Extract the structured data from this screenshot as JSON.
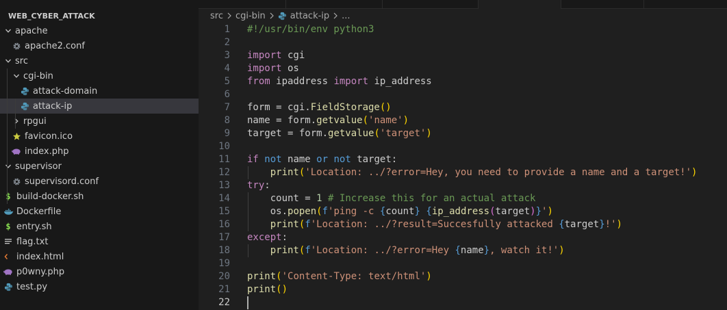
{
  "explorer": {
    "root_label": "WEB_CYBER_ATTACK",
    "items": [
      {
        "label": "apache",
        "kind": "folder",
        "icon": "chevron-down-icon",
        "file_icon": "",
        "depth": 0
      },
      {
        "label": "apache2.conf",
        "kind": "file",
        "icon": "",
        "file_icon": "gear-icon",
        "depth": 1
      },
      {
        "label": "src",
        "kind": "folder",
        "icon": "chevron-down-icon",
        "file_icon": "",
        "depth": 0
      },
      {
        "label": "cgi-bin",
        "kind": "folder",
        "icon": "chevron-down-icon",
        "file_icon": "",
        "depth": 1
      },
      {
        "label": "attack-domain",
        "kind": "file",
        "icon": "",
        "file_icon": "python-icon",
        "depth": 2
      },
      {
        "label": "attack-ip",
        "kind": "file",
        "icon": "",
        "file_icon": "python-icon",
        "depth": 2,
        "selected": true
      },
      {
        "label": "rpgui",
        "kind": "folder",
        "icon": "chevron-right-icon",
        "file_icon": "",
        "depth": 1
      },
      {
        "label": "favicon.ico",
        "kind": "file",
        "icon": "",
        "file_icon": "star-icon",
        "depth": 1
      },
      {
        "label": "index.php",
        "kind": "file",
        "icon": "",
        "file_icon": "php-icon",
        "depth": 1
      },
      {
        "label": "supervisor",
        "kind": "folder",
        "icon": "chevron-down-icon",
        "file_icon": "",
        "depth": 0
      },
      {
        "label": "supervisord.conf",
        "kind": "file",
        "icon": "",
        "file_icon": "gear-icon",
        "depth": 1
      },
      {
        "label": "build-docker.sh",
        "kind": "file",
        "icon": "",
        "file_icon": "shell-icon",
        "depth": 0
      },
      {
        "label": "Dockerfile",
        "kind": "file",
        "icon": "",
        "file_icon": "docker-icon",
        "depth": 0
      },
      {
        "label": "entry.sh",
        "kind": "file",
        "icon": "",
        "file_icon": "shell-icon",
        "depth": 0
      },
      {
        "label": "flag.txt",
        "kind": "file",
        "icon": "",
        "file_icon": "text-lines-icon",
        "depth": 0
      },
      {
        "label": "index.html",
        "kind": "file",
        "icon": "",
        "file_icon": "html-icon",
        "depth": 0
      },
      {
        "label": "p0wny.php",
        "kind": "file",
        "icon": "",
        "file_icon": "php-icon",
        "depth": 0
      },
      {
        "label": "test.py",
        "kind": "file",
        "icon": "",
        "file_icon": "python-icon",
        "depth": 0
      }
    ]
  },
  "breadcrumbs": {
    "parts": [
      "src",
      "cgi-bin",
      "attack-ip",
      "..."
    ],
    "file_icon": "python-icon"
  },
  "editor": {
    "current_line": 22,
    "lines": [
      {
        "n": "1",
        "tokens": [
          {
            "t": "#!/usr/bin/env python3",
            "c": "cm"
          }
        ]
      },
      {
        "n": "2",
        "tokens": []
      },
      {
        "n": "3",
        "tokens": [
          {
            "t": "import",
            "c": "kw"
          },
          {
            "t": " cgi",
            "c": "ident"
          }
        ]
      },
      {
        "n": "4",
        "tokens": [
          {
            "t": "import",
            "c": "kw"
          },
          {
            "t": " os",
            "c": "ident"
          }
        ]
      },
      {
        "n": "5",
        "tokens": [
          {
            "t": "from",
            "c": "kw"
          },
          {
            "t": " ipaddress ",
            "c": "ident"
          },
          {
            "t": "import",
            "c": "kw"
          },
          {
            "t": " ip_address",
            "c": "ident"
          }
        ]
      },
      {
        "n": "6",
        "tokens": []
      },
      {
        "n": "7",
        "tokens": [
          {
            "t": "form = cgi.",
            "c": "ident"
          },
          {
            "t": "FieldStorage",
            "c": "fn"
          },
          {
            "t": "()",
            "c": "br1"
          }
        ]
      },
      {
        "n": "8",
        "tokens": [
          {
            "t": "name = form.",
            "c": "ident"
          },
          {
            "t": "getvalue",
            "c": "fn"
          },
          {
            "t": "(",
            "c": "br1"
          },
          {
            "t": "'name'",
            "c": "str"
          },
          {
            "t": ")",
            "c": "br1"
          }
        ]
      },
      {
        "n": "9",
        "tokens": [
          {
            "t": "target = form.",
            "c": "ident"
          },
          {
            "t": "getvalue",
            "c": "fn"
          },
          {
            "t": "(",
            "c": "br1"
          },
          {
            "t": "'target'",
            "c": "str"
          },
          {
            "t": ")",
            "c": "br1"
          }
        ]
      },
      {
        "n": "10",
        "tokens": []
      },
      {
        "n": "11",
        "tokens": [
          {
            "t": "if",
            "c": "kw"
          },
          {
            "t": " ",
            "c": "ident"
          },
          {
            "t": "not",
            "c": "kb"
          },
          {
            "t": " name ",
            "c": "ident"
          },
          {
            "t": "or",
            "c": "kb"
          },
          {
            "t": " ",
            "c": "ident"
          },
          {
            "t": "not",
            "c": "kb"
          },
          {
            "t": " target:",
            "c": "ident"
          }
        ]
      },
      {
        "n": "12",
        "tokens": [
          {
            "t": "    ",
            "c": "ident"
          },
          {
            "t": "print",
            "c": "fn"
          },
          {
            "t": "(",
            "c": "br1"
          },
          {
            "t": "'Location: ../?error=Hey, you need to provide a name and a target!'",
            "c": "str"
          },
          {
            "t": ")",
            "c": "br1"
          }
        ]
      },
      {
        "n": "13",
        "tokens": [
          {
            "t": "try",
            "c": "kw"
          },
          {
            "t": ":",
            "c": "ident"
          }
        ]
      },
      {
        "n": "14",
        "tokens": [
          {
            "t": "    count = ",
            "c": "ident"
          },
          {
            "t": "1",
            "c": "num"
          },
          {
            "t": " ",
            "c": "ident"
          },
          {
            "t": "# Increase this for an actual attack",
            "c": "cm"
          }
        ]
      },
      {
        "n": "15",
        "tokens": [
          {
            "t": "    os.",
            "c": "ident"
          },
          {
            "t": "popen",
            "c": "fn"
          },
          {
            "t": "(",
            "c": "br1"
          },
          {
            "t": "f",
            "c": "fb"
          },
          {
            "t": "'ping -c ",
            "c": "str"
          },
          {
            "t": "{",
            "c": "fb"
          },
          {
            "t": "count",
            "c": "ident"
          },
          {
            "t": "}",
            "c": "fb"
          },
          {
            "t": " ",
            "c": "str"
          },
          {
            "t": "{",
            "c": "fb"
          },
          {
            "t": "ip_address",
            "c": "fn"
          },
          {
            "t": "(",
            "c": "br2"
          },
          {
            "t": "target",
            "c": "ident"
          },
          {
            "t": ")",
            "c": "br2"
          },
          {
            "t": "}",
            "c": "fb"
          },
          {
            "t": "'",
            "c": "str"
          },
          {
            "t": ")",
            "c": "br1"
          }
        ]
      },
      {
        "n": "16",
        "tokens": [
          {
            "t": "    ",
            "c": "ident"
          },
          {
            "t": "print",
            "c": "fn"
          },
          {
            "t": "(",
            "c": "br1"
          },
          {
            "t": "f",
            "c": "fb"
          },
          {
            "t": "'Location: ../?result=Succesfully attacked ",
            "c": "str"
          },
          {
            "t": "{",
            "c": "fb"
          },
          {
            "t": "target",
            "c": "ident"
          },
          {
            "t": "}",
            "c": "fb"
          },
          {
            "t": "!'",
            "c": "str"
          },
          {
            "t": ")",
            "c": "br1"
          }
        ]
      },
      {
        "n": "17",
        "tokens": [
          {
            "t": "except",
            "c": "kw"
          },
          {
            "t": ":",
            "c": "ident"
          }
        ]
      },
      {
        "n": "18",
        "tokens": [
          {
            "t": "    ",
            "c": "ident"
          },
          {
            "t": "print",
            "c": "fn"
          },
          {
            "t": "(",
            "c": "br1"
          },
          {
            "t": "f",
            "c": "fb"
          },
          {
            "t": "'Location: ../?error=Hey ",
            "c": "str"
          },
          {
            "t": "{",
            "c": "fb"
          },
          {
            "t": "name",
            "c": "ident"
          },
          {
            "t": "}",
            "c": "fb"
          },
          {
            "t": ", watch it!'",
            "c": "str"
          },
          {
            "t": ")",
            "c": "br1"
          }
        ]
      },
      {
        "n": "19",
        "tokens": []
      },
      {
        "n": "20",
        "tokens": [
          {
            "t": "print",
            "c": "fn"
          },
          {
            "t": "(",
            "c": "br1"
          },
          {
            "t": "'Content-Type: text/html'",
            "c": "str"
          },
          {
            "t": ")",
            "c": "br1"
          }
        ]
      },
      {
        "n": "21",
        "tokens": [
          {
            "t": "print",
            "c": "fn"
          },
          {
            "t": "()",
            "c": "br1"
          }
        ]
      },
      {
        "n": "22",
        "tokens": []
      }
    ]
  },
  "colors": {
    "sidebar_bg": "#181818",
    "editor_bg": "#1f1f1f",
    "selected_row": "#37373d",
    "python_icon": "#519aba",
    "gear_icon": "#8a9199",
    "star_icon": "#cbcb41",
    "php_icon": "#a074c4",
    "shell_icon": "#89e051",
    "docker_icon": "#519aba",
    "html_icon": "#e37933"
  }
}
